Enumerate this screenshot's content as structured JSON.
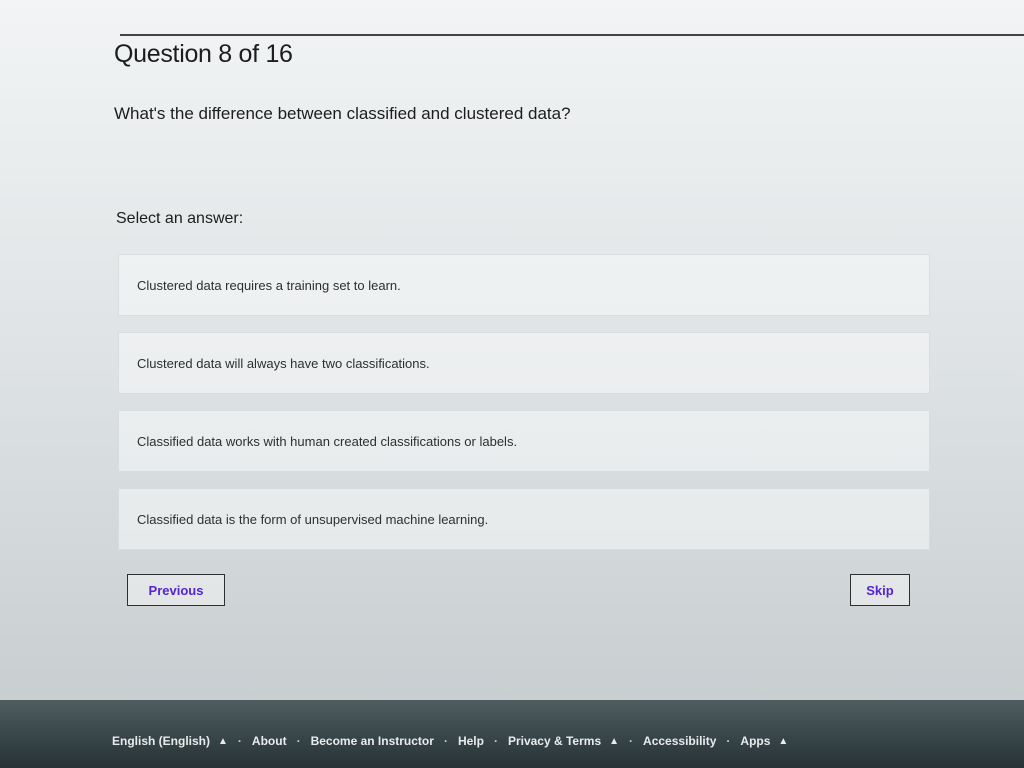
{
  "question": {
    "header": "Question 8 of 16",
    "text": "What's the difference between classified and clustered data?"
  },
  "answers": {
    "label": "Select an answer:",
    "options": [
      "Clustered data requires a training set to learn.",
      "Clustered data will always have two classifications.",
      "Classified data works with human created classifications or labels.",
      "Classified data is the form of unsupervised machine learning."
    ]
  },
  "navigation": {
    "previous_label": "Previous",
    "skip_label": "Skip"
  },
  "footer": {
    "language": "English (English)",
    "about": "About",
    "become_instructor": "Become an Instructor",
    "help": "Help",
    "privacy_terms": "Privacy & Terms",
    "accessibility": "Accessibility",
    "apps": "Apps",
    "separator": "·"
  },
  "colors": {
    "accent": "#5624d0",
    "text": "#1c1d1f"
  }
}
